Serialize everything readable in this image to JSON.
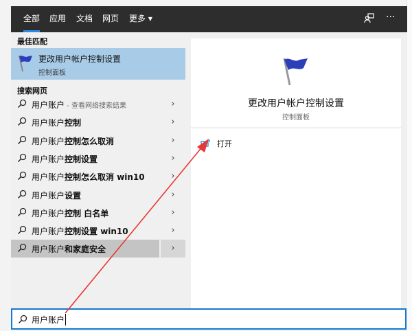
{
  "tabs": [
    {
      "label": "全部",
      "active": true
    },
    {
      "label": "应用"
    },
    {
      "label": "文档"
    },
    {
      "label": "网页"
    },
    {
      "label": "更多 ▾"
    }
  ],
  "header_icons": [
    "feedback-icon",
    "more-icon"
  ],
  "more_label": "···",
  "best_match": {
    "section": "最佳匹配",
    "title": "更改用户帐户控制设置",
    "subtitle": "控制面板"
  },
  "web_section": "搜索网页",
  "results": [
    {
      "bold": "",
      "text": "用户账户",
      "hint": " - 查看网络搜索结果"
    },
    {
      "bold": "控制",
      "text": "用户账户",
      "hint": ""
    },
    {
      "bold": "控制怎么取消",
      "text": "用户账户",
      "hint": ""
    },
    {
      "bold": "控制设置",
      "text": "用户账户",
      "hint": ""
    },
    {
      "bold": "控制怎么取消 win10",
      "text": "用户账户",
      "hint": ""
    },
    {
      "bold": "设置",
      "text": "用户账户",
      "hint": ""
    },
    {
      "bold": "控制 白名单",
      "text": "用户账户",
      "hint": ""
    },
    {
      "bold": "控制设置 win10",
      "text": "用户账户",
      "hint": ""
    },
    {
      "bold": "和家庭安全",
      "text": "用户账户",
      "hint": "",
      "selected": true
    }
  ],
  "detail": {
    "title": "更改用户帐户控制设置",
    "subtitle": "控制面板",
    "open_label": "打开"
  },
  "search": {
    "value": "用户账户"
  },
  "colors": {
    "accent": "#1479d0",
    "highlight": "#a8cce8",
    "annotation": "#e53935"
  }
}
